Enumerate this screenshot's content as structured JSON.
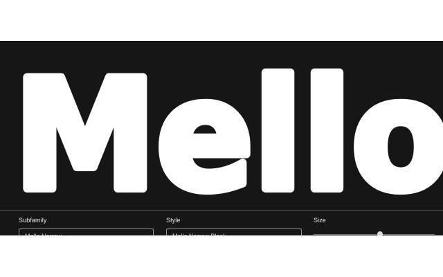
{
  "specimen": {
    "text": "Mello",
    "text_color": "#ffffff",
    "background_color": "#161616"
  },
  "controls": {
    "subfamily": {
      "label": "Subfamily",
      "value": "Mello Narrow"
    },
    "style": {
      "label": "Style",
      "value": "Mello Narrow Black"
    },
    "size": {
      "label": "Size"
    }
  }
}
